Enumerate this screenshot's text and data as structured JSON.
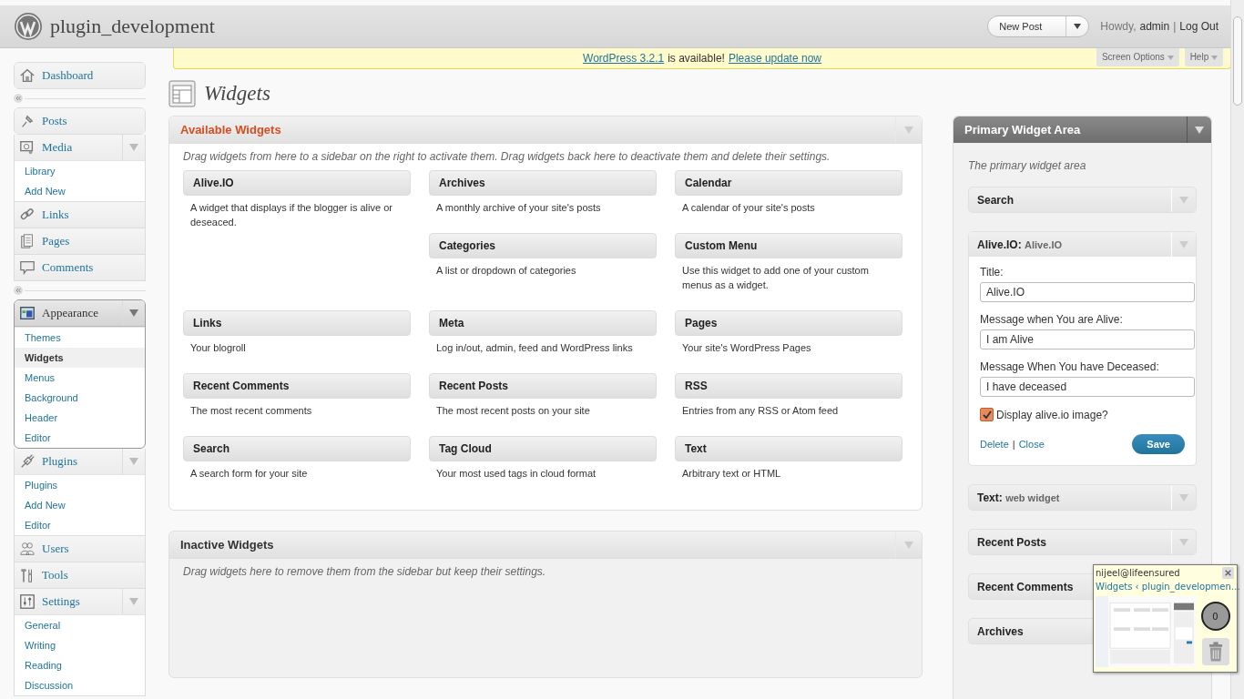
{
  "header": {
    "site_title": "plugin_development",
    "new_post": "New Post",
    "greeting": "Howdy,",
    "user": "admin",
    "separator": "|",
    "logout": "Log Out"
  },
  "notice": {
    "link1": "WordPress 3.2.1",
    "middle": "is available!",
    "link2": "Please update now",
    "tabs": [
      "Screen Options",
      "Help"
    ]
  },
  "menu": [
    {
      "kind": "item",
      "label": "Dashboard",
      "toggle": false,
      "current": false
    },
    {
      "kind": "separator"
    },
    {
      "kind": "item",
      "label": "Posts",
      "toggle": false,
      "current": false
    },
    {
      "kind": "item",
      "label": "Media",
      "toggle": true,
      "current": false,
      "children": [
        {
          "label": "Library",
          "selected": false
        },
        {
          "label": "Add New",
          "selected": false
        }
      ]
    },
    {
      "kind": "item",
      "label": "Links",
      "toggle": false,
      "current": false
    },
    {
      "kind": "item",
      "label": "Pages",
      "toggle": false,
      "current": false
    },
    {
      "kind": "item",
      "label": "Comments",
      "toggle": false,
      "current": false
    },
    {
      "kind": "separator"
    },
    {
      "kind": "item",
      "label": "Appearance",
      "toggle": true,
      "current": true,
      "children": [
        {
          "label": "Themes",
          "selected": false
        },
        {
          "label": "Widgets",
          "selected": true
        },
        {
          "label": "Menus",
          "selected": false
        },
        {
          "label": "Background",
          "selected": false
        },
        {
          "label": "Header",
          "selected": false
        },
        {
          "label": "Editor",
          "selected": false
        }
      ]
    },
    {
      "kind": "item",
      "label": "Plugins",
      "toggle": true,
      "current": false,
      "children": [
        {
          "label": "Plugins",
          "selected": false
        },
        {
          "label": "Add New",
          "selected": false
        },
        {
          "label": "Editor",
          "selected": false
        }
      ]
    },
    {
      "kind": "item",
      "label": "Users",
      "toggle": false,
      "current": false
    },
    {
      "kind": "item",
      "label": "Tools",
      "toggle": false,
      "current": false
    },
    {
      "kind": "item",
      "label": "Settings",
      "toggle": true,
      "current": false,
      "children": [
        {
          "label": "General",
          "selected": false
        },
        {
          "label": "Writing",
          "selected": false
        },
        {
          "label": "Reading",
          "selected": false
        },
        {
          "label": "Discussion",
          "selected": false
        }
      ]
    }
  ],
  "page_title": "Widgets",
  "available": {
    "title": "Available Widgets",
    "description": "Drag widgets from here to a sidebar on the right to activate them. Drag widgets back here to deactivate them and delete their settings.",
    "widgets": [
      {
        "title": "Alive.IO",
        "description": "A widget that displays if the blogger is alive or deseaced."
      },
      {
        "title": "Archives",
        "description": "A monthly archive of your site's posts"
      },
      {
        "title": "Calendar",
        "description": "A calendar of your site's posts"
      },
      {
        "title": "Categories",
        "description": "A list or dropdown of categories"
      },
      {
        "title": "Custom Menu",
        "description": "Use this widget to add one of your custom menus as a widget."
      },
      {
        "title": "Links",
        "description": "Your blogroll"
      },
      {
        "title": "Meta",
        "description": "Log in/out, admin, feed and WordPress links"
      },
      {
        "title": "Pages",
        "description": "Your site's WordPress Pages"
      },
      {
        "title": "Recent Comments",
        "description": "The most recent comments"
      },
      {
        "title": "Recent Posts",
        "description": "The most recent posts on your site"
      },
      {
        "title": "RSS",
        "description": "Entries from any RSS or Atom feed"
      },
      {
        "title": "Search",
        "description": "A search form for your site"
      },
      {
        "title": "Tag Cloud",
        "description": "Your most used tags in cloud format"
      },
      {
        "title": "Text",
        "description": "Arbitrary text or HTML"
      }
    ]
  },
  "inactive": {
    "title": "Inactive Widgets",
    "description": "Drag widgets here to remove them from the sidebar but keep their settings."
  },
  "sidebar_area": {
    "title": "Primary Widget Area",
    "description": "The primary widget area",
    "widgets": [
      {
        "title": "Search",
        "expanded": false
      },
      {
        "title": "Alive.IO",
        "colon": ":",
        "subtitle": "Alive.IO",
        "expanded": true
      },
      {
        "title": "Text",
        "colon": ":",
        "subtitle": "web widget",
        "expanded": false
      },
      {
        "title": "Recent Posts",
        "expanded": false
      },
      {
        "title": "Recent Comments",
        "expanded": false
      },
      {
        "title": "Archives",
        "expanded": false
      }
    ],
    "form": {
      "fields": [
        {
          "label": "Title:",
          "value": "Alive.IO"
        },
        {
          "label": "Message when You are Alive:",
          "value": "I am Alive"
        },
        {
          "label": "Message When You have Deceased:",
          "value": "I have deceased"
        }
      ],
      "checkbox": {
        "label": "Display alive.io image?",
        "checked": true
      },
      "delete": "Delete",
      "separator": "|",
      "close": "Close",
      "save": "Save"
    }
  },
  "notification": {
    "user": "nijeel@lifeensured",
    "window": "Widgets ‹ plugin_developmen…",
    "count": "0"
  }
}
